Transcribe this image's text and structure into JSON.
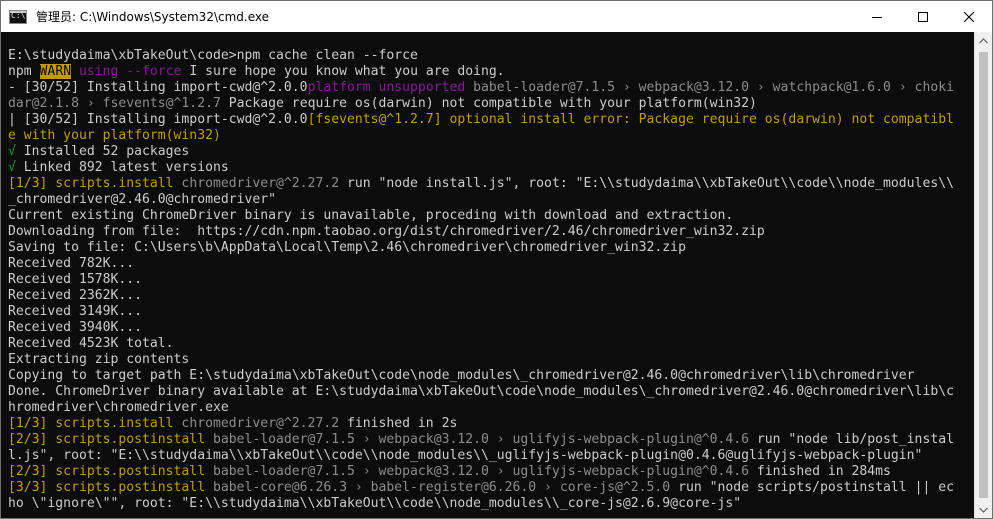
{
  "window": {
    "title": "管理员: C:\\Windows\\System32\\cmd.exe",
    "icon": "cmd-icon"
  },
  "caption_buttons": {
    "minimize": "minimize-icon",
    "maximize": "maximize-icon",
    "close": "close-icon"
  },
  "colors": {
    "background": "#0c0c0c",
    "default_text": "#cccccc",
    "green": "#13a10e",
    "yellow": "#c19c00",
    "magenta": "#881798",
    "gray": "#8c8c8c"
  },
  "console_lines": [
    [
      {
        "t": "E:\\studydaima\\xbTakeOut\\code>npm cache clean --force",
        "c": "w"
      }
    ],
    [
      {
        "t": "npm ",
        "c": "w"
      },
      {
        "t": "WARN",
        "c": "warn"
      },
      {
        "t": " ",
        "c": "w"
      },
      {
        "t": "using --force",
        "c": "m"
      },
      {
        "t": " I sure hope you know what you are doing.",
        "c": "w"
      }
    ],
    [
      {
        "t": "- [30/52] Installing import-cwd@^2.0.0",
        "c": "w"
      },
      {
        "t": "platform unsupported",
        "c": "m"
      },
      {
        "t": " babel-loader@7.1.5 › webpack@3.12.0 › watchpack@1.6.0 › choki",
        "c": "gray"
      }
    ],
    [
      {
        "t": "dar@2.1.8 › fsevents@^1.2.7",
        "c": "gray"
      },
      {
        "t": " Package require os(darwin) not compatible with your platform(win32)",
        "c": "w"
      }
    ],
    [
      {
        "t": "| [30/52] Installing import-cwd@^2.0.0",
        "c": "w"
      },
      {
        "t": "[fsevents@^1.2.7] optional install error: Package require os(darwin) not compatibl",
        "c": "y"
      }
    ],
    [
      {
        "t": "e with your platform(win32)",
        "c": "y"
      }
    ],
    [
      {
        "t": "√",
        "c": "g"
      },
      {
        "t": " Installed 52 packages",
        "c": "w"
      }
    ],
    [
      {
        "t": "√",
        "c": "g"
      },
      {
        "t": " Linked 892 latest versions",
        "c": "w"
      }
    ],
    [
      {
        "t": "[1/3] scripts.install",
        "c": "y"
      },
      {
        "t": " chromedriver@^2.27.2",
        "c": "gray"
      },
      {
        "t": " run \"node install.js\", root: \"E:\\\\studydaima\\\\xbTakeOut\\\\code\\\\node_modules\\\\",
        "c": "w"
      }
    ],
    [
      {
        "t": "_chromedriver@2.46.0@chromedriver\"",
        "c": "w"
      }
    ],
    [
      {
        "t": "Current existing ChromeDriver binary is unavailable, proceding with download and extraction.",
        "c": "w"
      }
    ],
    [
      {
        "t": "Downloading from file:  https://cdn.npm.taobao.org/dist/chromedriver/2.46/chromedriver_win32.zip",
        "c": "w"
      }
    ],
    [
      {
        "t": "Saving to file: C:\\Users\\b\\AppData\\Local\\Temp\\2.46\\chromedriver\\chromedriver_win32.zip",
        "c": "w"
      }
    ],
    [
      {
        "t": "Received 782K...",
        "c": "w"
      }
    ],
    [
      {
        "t": "Received 1578K...",
        "c": "w"
      }
    ],
    [
      {
        "t": "Received 2362K...",
        "c": "w"
      }
    ],
    [
      {
        "t": "Received 3149K...",
        "c": "w"
      }
    ],
    [
      {
        "t": "Received 3940K...",
        "c": "w"
      }
    ],
    [
      {
        "t": "Received 4523K total.",
        "c": "w"
      }
    ],
    [
      {
        "t": "Extracting zip contents",
        "c": "w"
      }
    ],
    [
      {
        "t": "Copying to target path E:\\studydaima\\xbTakeOut\\code\\node_modules\\_chromedriver@2.46.0@chromedriver\\lib\\chromedriver",
        "c": "w"
      }
    ],
    [
      {
        "t": "Done. ChromeDriver binary available at E:\\studydaima\\xbTakeOut\\code\\node_modules\\_chromedriver@2.46.0@chromedriver\\lib\\c",
        "c": "w"
      }
    ],
    [
      {
        "t": "hromedriver\\chromedriver.exe",
        "c": "w"
      }
    ],
    [
      {
        "t": "[1/3] scripts.install",
        "c": "y"
      },
      {
        "t": " chromedriver@^2.27.2",
        "c": "gray"
      },
      {
        "t": " finished in 2s",
        "c": "w"
      }
    ],
    [
      {
        "t": "[2/3] scripts.postinstall",
        "c": "y"
      },
      {
        "t": " babel-loader@7.1.5 › webpack@3.12.0 › uglifyjs-webpack-plugin@^0.4.6",
        "c": "gray"
      },
      {
        "t": " run \"node lib/post_instal",
        "c": "w"
      }
    ],
    [
      {
        "t": "l.js\", root: \"E:\\\\studydaima\\\\xbTakeOut\\\\code\\\\node_modules\\\\_uglifyjs-webpack-plugin@0.4.6@uglifyjs-webpack-plugin\"",
        "c": "w"
      }
    ],
    [
      {
        "t": "[2/3] scripts.postinstall",
        "c": "y"
      },
      {
        "t": " babel-loader@7.1.5 › webpack@3.12.0 › uglifyjs-webpack-plugin@^0.4.6",
        "c": "gray"
      },
      {
        "t": " finished in 284ms",
        "c": "w"
      }
    ],
    [
      {
        "t": "[3/3] scripts.postinstall",
        "c": "y"
      },
      {
        "t": " babel-core@6.26.3 › babel-register@6.26.0 › core-js@^2.5.0",
        "c": "gray"
      },
      {
        "t": " run \"node scripts/postinstall || ec",
        "c": "w"
      }
    ],
    [
      {
        "t": "ho \\\"ignore\\\"\", root: \"E:\\\\studydaima\\\\xbTakeOut\\\\code\\\\node_modules\\\\_core-js@2.6.9@core-js\"",
        "c": "w"
      }
    ]
  ],
  "scrollbar": {
    "up": "scroll-up-arrow-icon",
    "down": "scroll-down-arrow-icon",
    "position_fraction": 1.0
  }
}
